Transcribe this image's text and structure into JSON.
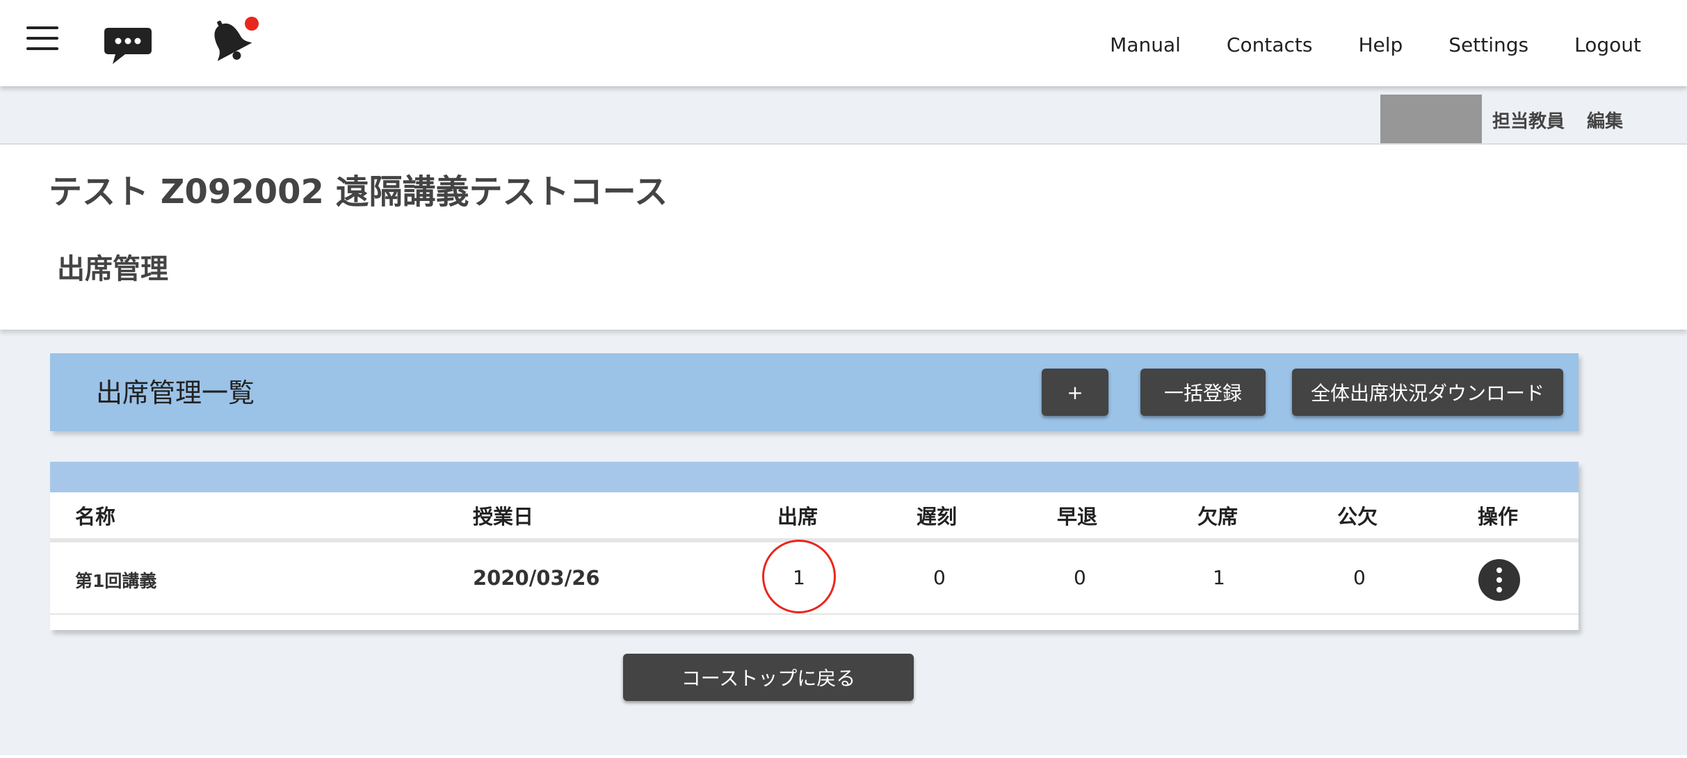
{
  "header": {
    "nav": [
      "Manual",
      "Contacts",
      "Help",
      "Settings",
      "Logout"
    ],
    "icons": {
      "menu": "hamburger-menu-icon",
      "chat": "chat-bubble-icon",
      "notify": "bell-icon"
    },
    "notification_dot_color": "#e8271f"
  },
  "teacher": {
    "label": "担当教員",
    "edit": "編集"
  },
  "course": {
    "title": "テスト Z092002 遠隔講義テストコース"
  },
  "section": {
    "title": "出席管理"
  },
  "list": {
    "title": "出席管理一覧",
    "add_label": "+",
    "bulk_label": "一括登録",
    "download_label": "全体出席状況ダウンロード"
  },
  "table": {
    "headers": [
      "名称",
      "授業日",
      "出席",
      "遅刻",
      "早退",
      "欠席",
      "公欠",
      "操作"
    ],
    "rows": [
      {
        "name": "第1回講義",
        "date": "2020/03/26",
        "present": "1",
        "late": "0",
        "early_leave": "0",
        "absent": "1",
        "excused": "0"
      }
    ]
  },
  "footer": {
    "back_label": "コーストップに戻る"
  },
  "colors": {
    "accent_blue": "#9bc2e7",
    "button_dark": "#444444",
    "highlight_red": "#e8271f"
  }
}
